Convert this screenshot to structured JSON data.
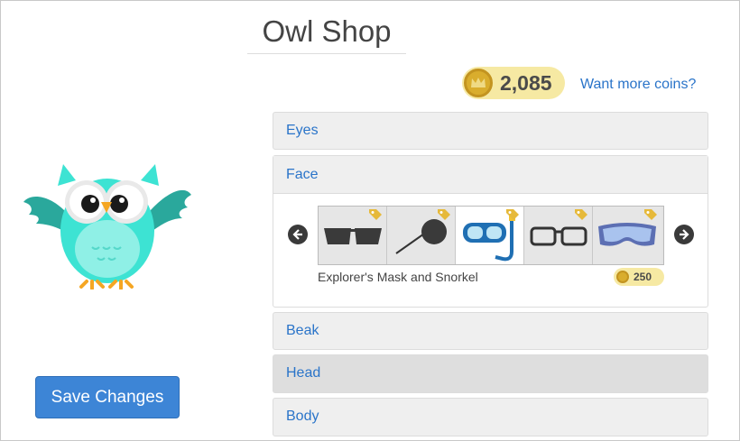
{
  "page": {
    "title": "Owl Shop"
  },
  "wallet": {
    "coins": "2,085",
    "more_link": "Want more coins?"
  },
  "actions": {
    "save_label": "Save Changes"
  },
  "colors": {
    "accent": "#3d85d6",
    "link": "#2a74c9",
    "owl": "#3de3d3",
    "coin": "#d9ad2d",
    "coin_bg": "#f6e9a3"
  },
  "categories": [
    {
      "label": "Eyes",
      "expanded": false
    },
    {
      "label": "Face",
      "expanded": true
    },
    {
      "label": "Beak",
      "expanded": false
    },
    {
      "label": "Head",
      "expanded": false,
      "highlighted": true
    },
    {
      "label": "Body",
      "expanded": false
    }
  ],
  "face_items": [
    {
      "icon": "sunglasses-icon",
      "selected": false,
      "tagged": true
    },
    {
      "icon": "eye-patch-icon",
      "selected": false,
      "tagged": true
    },
    {
      "icon": "snorkel-mask-icon",
      "selected": true,
      "tagged": true
    },
    {
      "icon": "glasses-icon",
      "selected": false,
      "tagged": true
    },
    {
      "icon": "ski-goggles-icon",
      "selected": false,
      "tagged": true
    }
  ],
  "selected_item": {
    "name": "Explorer's Mask and Snorkel",
    "price": "250"
  }
}
